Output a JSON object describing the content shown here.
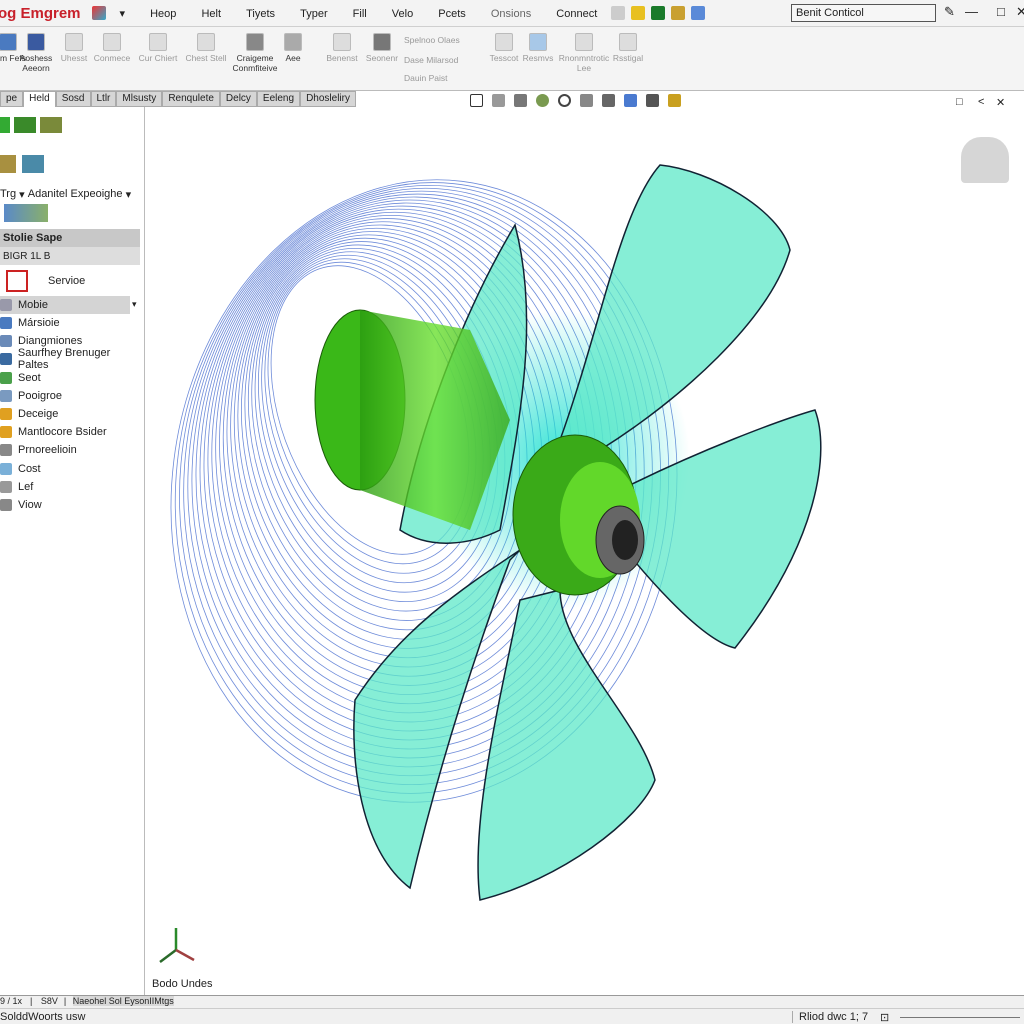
{
  "titlebar": {
    "app_title": "og Emgrem",
    "menu": [
      "Heop",
      "Helt",
      "Tiyets",
      "Typer",
      "Fill",
      "Velo",
      "Pcets",
      "Onsions",
      "Connect"
    ],
    "search_value": "Benit Conticol"
  },
  "ribbon": {
    "buttons": [
      "Asm Fefs",
      "Aoshess Aeeorn",
      "Uhesst",
      "Conmece",
      "Cur Chiert",
      "Chest Stell",
      "Craigeme Conmfiteive",
      "Aee",
      "Benenst",
      "Seonenr",
      "Spelnoo Olaes",
      "Dase Milarsod",
      "Dauin Paist",
      "Tesscot",
      "Resmvs",
      "Rnonmntrotic Lee",
      "Rsstigal"
    ]
  },
  "tabs": [
    "pe",
    "Held",
    "Sosd",
    "Ltlr",
    "Mlsusty",
    "Renqulete",
    "Delcy",
    "Eeleng",
    "Dhosleliry"
  ],
  "panel": {
    "dropdown1": "Trg",
    "dropdown2": "Adanitel Expeoighe",
    "section_header": "Stolie Sape",
    "section_sub": "BIGR 1L B",
    "service": "Servioe",
    "selected": "Mobie",
    "items": [
      "Mársioie",
      "Diangmiones",
      "Saurfhey Brenuger Paltes",
      "Seot",
      "Pooigroe",
      "Deceige",
      "Mantlocore Bsider",
      "Prnoreelioin",
      "Cost",
      "Lef",
      "Viow"
    ]
  },
  "viewport": {
    "axis_label": "Bodo Undes"
  },
  "bottom_tabs": [
    "9 / 1x",
    "S8V",
    "Naeohel Sol EysonIIMtgs"
  ],
  "status": {
    "left": "SolddWoorts usw",
    "right": "Rliod dwc 1; 7"
  },
  "colors": {
    "blade": "#5ee8c8",
    "hub": "#44cc22",
    "flow": "#4a6fd0",
    "accent": "#c8202a"
  }
}
